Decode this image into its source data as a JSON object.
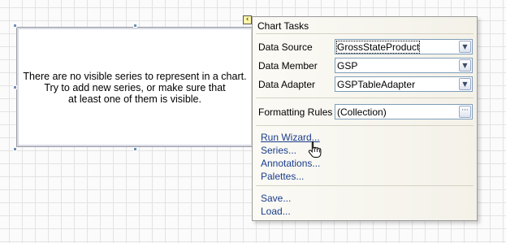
{
  "chart": {
    "message_lines": [
      "There are no visible series to represent in a chart.",
      "Try to add new series, or make sure that",
      "at least one of them is visible."
    ]
  },
  "smart_tag": {
    "icon": "chevron-left-icon",
    "glyph": "‹"
  },
  "panel": {
    "title": "Chart Tasks",
    "properties": [
      {
        "label": "Data Source",
        "value": "GrossStateProduct",
        "button": "dropdown"
      },
      {
        "label": "Data Member",
        "value": "GSP",
        "button": "dropdown"
      },
      {
        "label": "Data Adapter",
        "value": "GSPTableAdapter",
        "button": "dropdown"
      },
      {
        "label": "Formatting Rules",
        "value": "(Collection)",
        "button": "ellipsis"
      }
    ],
    "links": [
      "Run Wizard...",
      "Series...",
      "Annotations...",
      "Palettes..."
    ],
    "file_links": [
      "Save...",
      "Load..."
    ],
    "dropdown_glyph": "▼",
    "ellipsis_glyph": "···"
  },
  "colors": {
    "link": "#1a3c8c",
    "handle": "#6d8fb4",
    "panel_bg": "#f6f4ec"
  }
}
